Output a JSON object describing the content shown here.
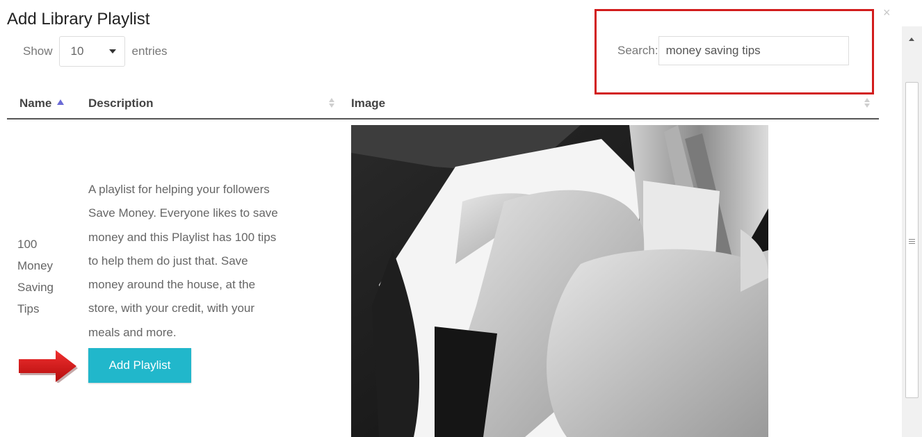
{
  "dialog": {
    "title": "Add Library Playlist",
    "close_symbol": "×"
  },
  "length_control": {
    "show_label": "Show",
    "selected_value": "10",
    "entries_label": "entries"
  },
  "search": {
    "label": "Search:",
    "value": "money saving tips"
  },
  "table": {
    "columns": [
      "Name",
      "Description",
      "Image"
    ],
    "rows": [
      {
        "name_lines": [
          "100",
          "Money",
          "Saving",
          "Tips"
        ],
        "description_lines": [
          "A playlist for helping your followers",
          "Save Money. Everyone likes to save",
          "money and this Playlist has 100 tips",
          "to help them do just that. Save",
          "money around the house, at the",
          "store, with your credit, with your",
          "meals and more."
        ],
        "action_label": "Add Playlist",
        "image": "wallet-with-dollar-bills-photo"
      }
    ]
  },
  "colors": {
    "highlight_box": "#d21c1c",
    "annotation_arrow": "#e01515",
    "button": "#21b7cb",
    "sort_active": "#6b6bd6"
  },
  "icons": [
    "close-icon",
    "caret-down-icon",
    "sort-asc-icon",
    "sort-icon",
    "arrow-right-icon",
    "scroll-up-icon"
  ]
}
